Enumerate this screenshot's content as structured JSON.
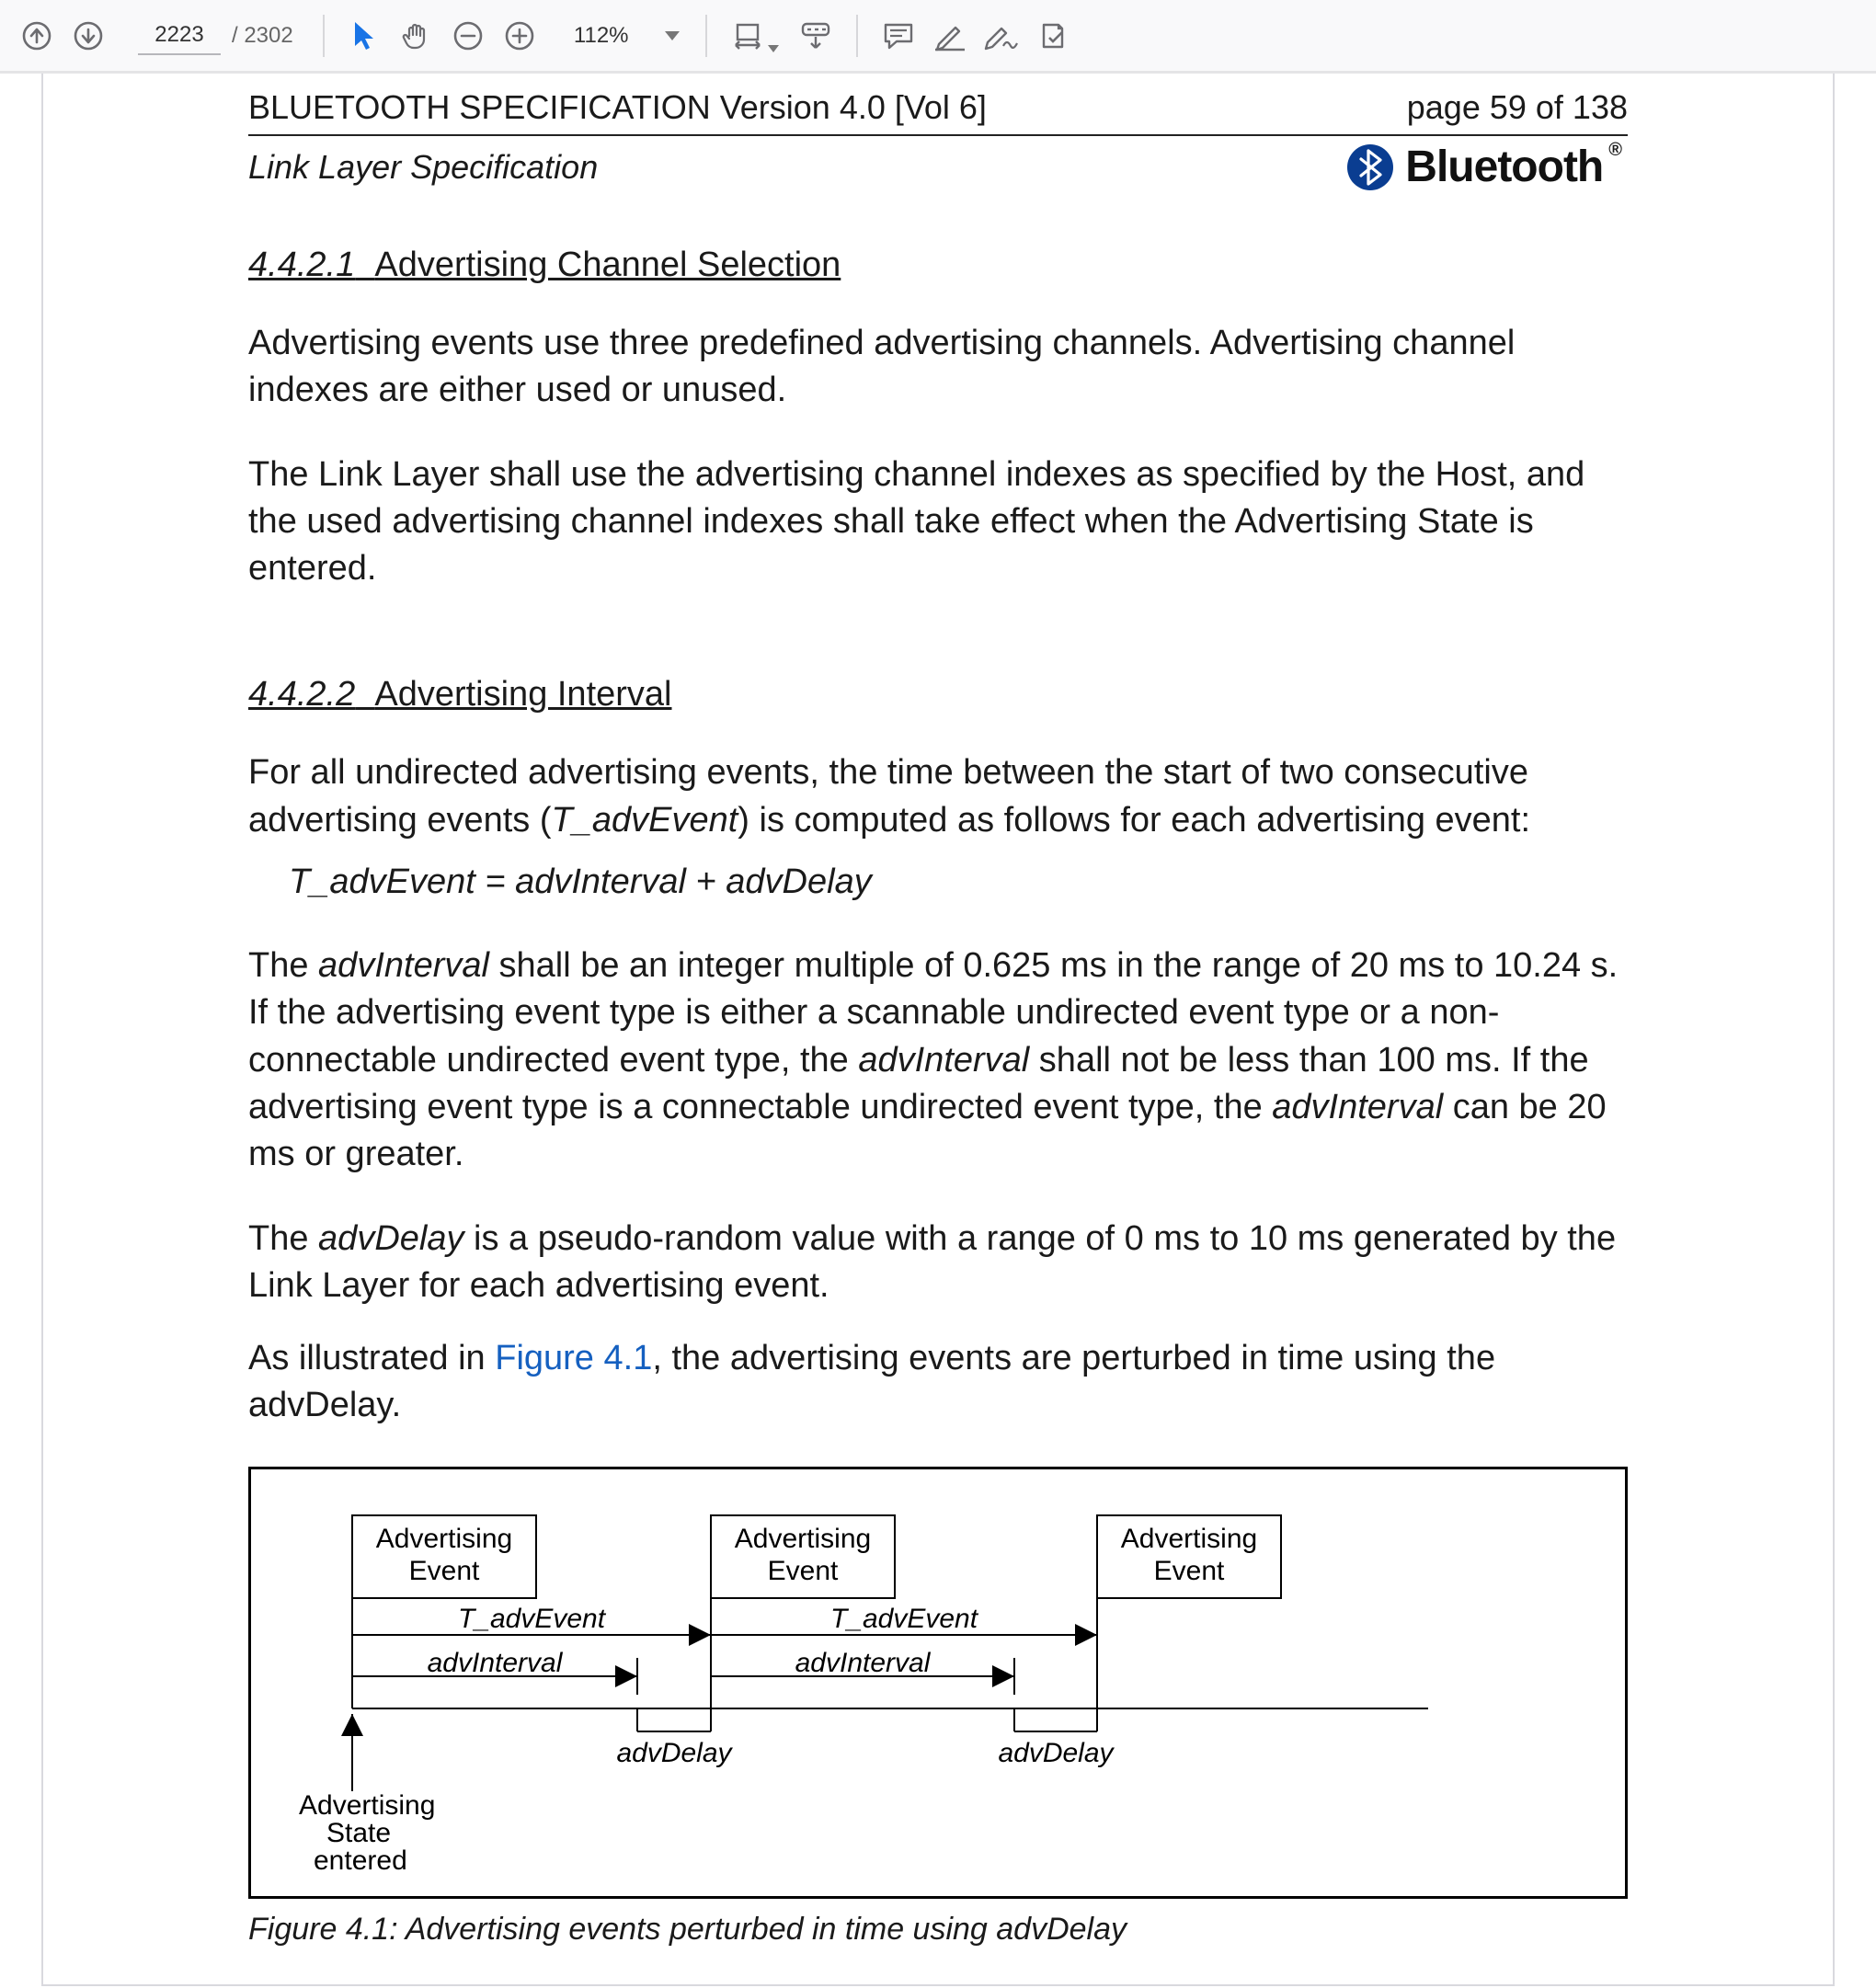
{
  "toolbar": {
    "current_page": "2223",
    "total_pages": "/ 2302",
    "zoom": "112%"
  },
  "header": {
    "title_left": "BLUETOOTH SPECIFICATION Version 4.0 [Vol 6]",
    "page_label": "page 59 of 138",
    "subhead": "Link Layer Specification",
    "brand_word": "Bluetooth"
  },
  "section1": {
    "heading_num": "4.4.2.1",
    "heading_text": "Advertising Channel Selection",
    "p1": "Advertising events use three predefined advertising channels. Advertising channel indexes are either used or unused.",
    "p2": "The Link Layer shall use the advertising channel indexes as specified by the Host, and the used advertising channel indexes shall take effect when the Advertising State is entered."
  },
  "section2": {
    "heading_num": "4.4.2.2",
    "heading_text": "Advertising Interval",
    "p1a": "For all undirected advertising events, the time between the start of two consecutive advertising events (",
    "p1b": "T_advEvent",
    "p1c": ") is computed as follows for each advertising event:",
    "formula": "T_advEvent = advInterval + advDelay",
    "p2a": "The ",
    "p2b": "advInterval",
    "p2c": " shall be an integer multiple of 0.625 ms in the range of 20 ms to 10.24 s. If the advertising event type is either a scannable undirected event type or a non-connectable undirected event type, the ",
    "p2d": "advInterval",
    "p2e": " shall not be less than 100 ms. If the advertising event type is a connectable undirected event type, the ",
    "p2f": "advInterval",
    "p2g": " can be 20 ms or greater.",
    "p3a": "The ",
    "p3b": "advDelay",
    "p3c": " is a pseudo-random value with a range of 0 ms to 10 ms generated by the Link Layer for each advertising event.",
    "p4a": "As illustrated in ",
    "p4b": "Figure 4.1",
    "p4c": ", the advertising events are perturbed in time using the advDelay."
  },
  "figure": {
    "box_label": "Advertising\nEvent",
    "t_adv": "T_advEvent",
    "advInterval": "advInterval",
    "advDelay": "advDelay",
    "state_label": "Advertising\nState\nentered",
    "caption": "Figure 4.1: Advertising events perturbed in time using advDelay"
  }
}
